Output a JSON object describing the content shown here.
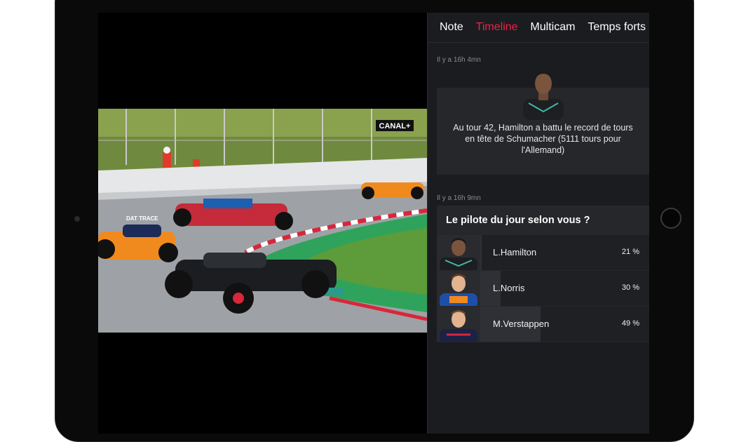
{
  "tabs": [
    {
      "label": "Note",
      "active": false
    },
    {
      "label": "Timeline",
      "active": true
    },
    {
      "label": "Multicam",
      "active": false
    },
    {
      "label": "Temps forts",
      "active": false
    }
  ],
  "accent_color": "#e8224a",
  "video": {
    "broadcaster_logo": "CANAL+",
    "sponsor_logo": "DAT TRACE"
  },
  "timeline": [
    {
      "timestamp": "Il y a 16h 4mn",
      "driver_icon": "hamilton-portrait",
      "text": "Au tour 42, Hamilton a battu le record de tours en tête de Schumacher (5111 tours pour l'Allemand)"
    },
    {
      "timestamp": "Il y a 16h 9mn",
      "poll": {
        "question": "Le pilote du jour selon vous ?",
        "options": [
          {
            "name": "L.Hamilton",
            "percent": "21 %",
            "share": 0.21,
            "avatar": "hamilton-avatar"
          },
          {
            "name": "L.Norris",
            "percent": "30 %",
            "share": 0.3,
            "avatar": "norris-avatar"
          },
          {
            "name": "M.Verstappen",
            "percent": "49 %",
            "share": 0.49,
            "avatar": "verstappen-avatar"
          }
        ]
      }
    }
  ]
}
